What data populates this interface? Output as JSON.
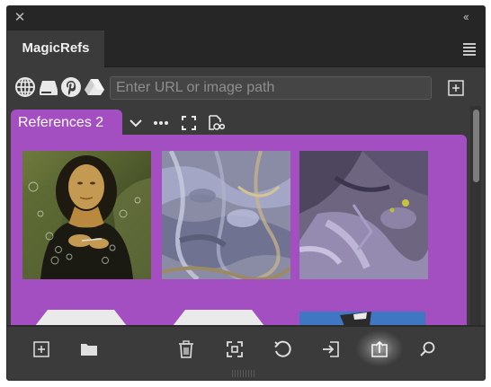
{
  "window": {
    "close_glyph": "✕",
    "collapse_glyph": "‹‹"
  },
  "panel": {
    "tab_title": "MagicRefs"
  },
  "url_bar": {
    "placeholder": "Enter URL or image path",
    "value": "",
    "source_icons": [
      "globe-icon",
      "drive-icon",
      "pinterest-icon",
      "google-drive-icon"
    ]
  },
  "collection": {
    "name": "References 2",
    "tools": [
      "chevron-down-icon",
      "more-icon",
      "fullscreen-icon",
      "find-image-icon"
    ]
  },
  "board": {
    "color": "#a44fc1",
    "images": [
      {
        "name": "mona-lisa-bubbles-image"
      },
      {
        "name": "satellite-terrain-image-1"
      },
      {
        "name": "satellite-terrain-image-2"
      }
    ]
  },
  "toolbar": {
    "buttons": [
      "add-board-icon",
      "folder-icon",
      "trash-icon",
      "fit-icon",
      "reset-icon",
      "import-icon",
      "export-icon",
      "search-icon"
    ]
  },
  "colors": {
    "panel_bg": "#3b3b3b",
    "header_bg": "#262626",
    "accent_purple": "#a44fc1"
  }
}
